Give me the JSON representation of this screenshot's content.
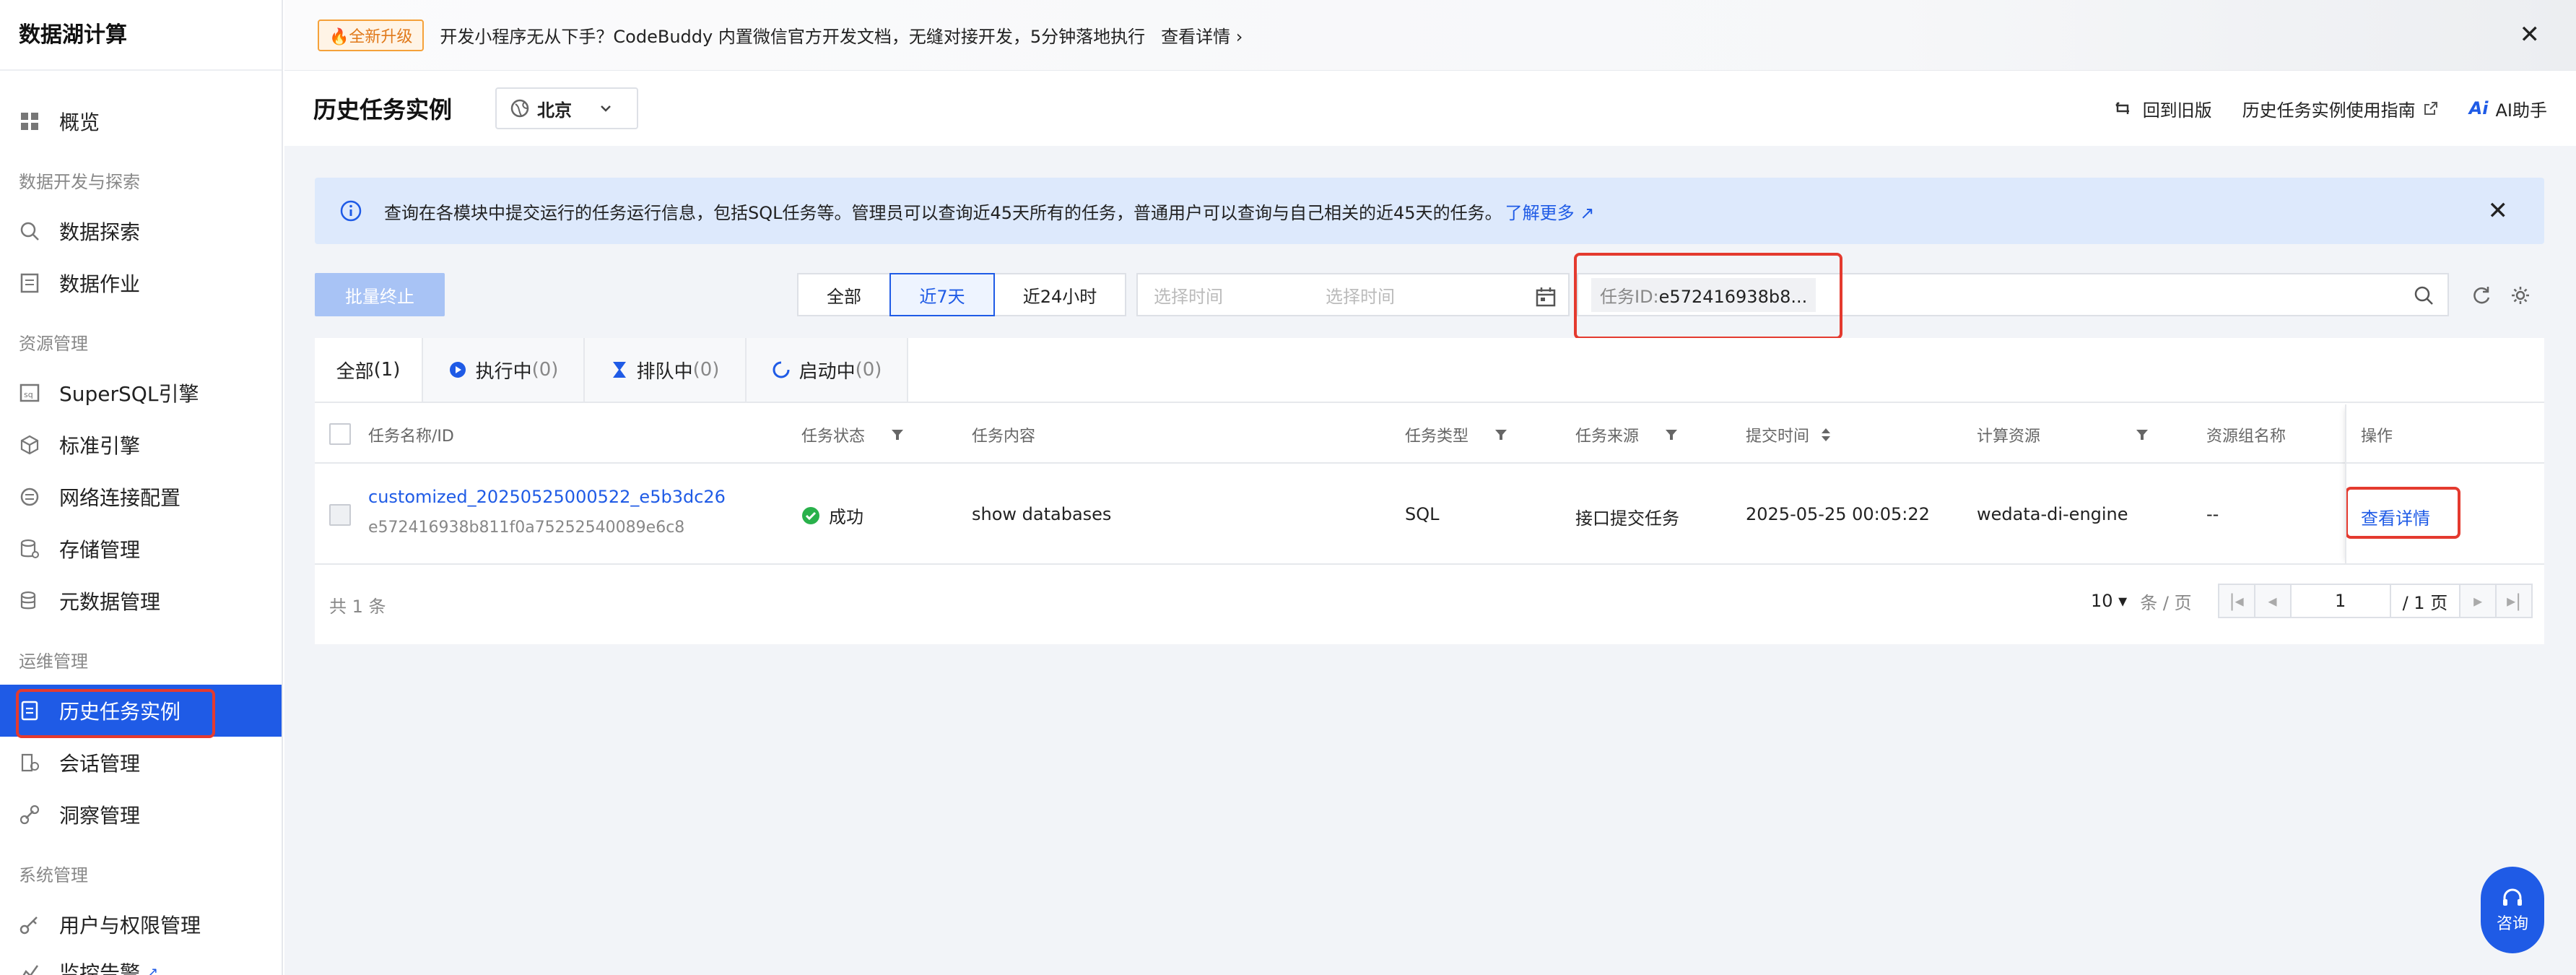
{
  "app": {
    "title": "数据湖计算"
  },
  "sidebar": {
    "items": [
      {
        "label": "概览",
        "icon": "dashboard-icon"
      },
      {
        "group": "数据开发与探索"
      },
      {
        "label": "数据探索",
        "icon": "explore-icon"
      },
      {
        "label": "数据作业",
        "icon": "job-icon"
      },
      {
        "group": "资源管理"
      },
      {
        "label": "SuperSQL引擎",
        "icon": "sql-engine-icon"
      },
      {
        "label": "标准引擎",
        "icon": "cube-icon"
      },
      {
        "label": "网络连接配置",
        "icon": "network-icon"
      },
      {
        "label": "存储管理",
        "icon": "storage-icon"
      },
      {
        "label": "元数据管理",
        "icon": "metadata-icon"
      },
      {
        "group": "运维管理"
      },
      {
        "label": "历史任务实例",
        "icon": "history-icon",
        "active": true
      },
      {
        "label": "会话管理",
        "icon": "session-icon"
      },
      {
        "label": "洞察管理",
        "icon": "insight-icon"
      },
      {
        "group": "系统管理"
      },
      {
        "label": "用户与权限管理",
        "icon": "key-icon"
      },
      {
        "label": "监控告警",
        "icon": "monitor-icon"
      }
    ]
  },
  "banner": {
    "badge": "全新升级",
    "text": "开发小程序无从下手？CodeBuddy 内置微信官方开发文档，无缝对接开发，5分钟落地执行",
    "link": "查看详情"
  },
  "header": {
    "title": "历史任务实例",
    "region": "北京",
    "actions": {
      "old_version": "回到旧版",
      "guide": "历史任务实例使用指南",
      "ai": "AI助手"
    }
  },
  "notice": {
    "text": "查询在各模块中提交运行的任务运行信息，包括SQL任务等。管理员可以查询近45天所有的任务，普通用户可以查询与自己相关的近45天的任务。",
    "link": "了解更多"
  },
  "toolbar": {
    "batch_stop": "批量终止",
    "ranges": [
      "全部",
      "近7天",
      "近24小时"
    ],
    "active_range": "近7天",
    "start_placeholder": "选择时间",
    "end_placeholder": "选择时间",
    "filter_key": "任务ID:",
    "filter_value": "e572416938b8..."
  },
  "tabs": [
    {
      "label": "全部",
      "count": "(1)"
    },
    {
      "label": "执行中",
      "count": "(0)"
    },
    {
      "label": "排队中",
      "count": "(0)"
    },
    {
      "label": "启动中",
      "count": "(0)"
    }
  ],
  "table": {
    "columns": [
      "任务名称/ID",
      "任务状态",
      "任务内容",
      "任务类型",
      "任务来源",
      "提交时间",
      "计算资源",
      "资源组名称",
      "操作"
    ],
    "rows": [
      {
        "name": "customized_20250525000522_e5b3dc26",
        "id": "e572416938b811f0a75252540089e6c8",
        "status": "成功",
        "content": "show databases",
        "type": "SQL",
        "source": "接口提交任务",
        "submit_time": "2025-05-25 00:05:22",
        "resource": "wedata-di-engine",
        "group": "--",
        "action": "查看详情"
      }
    ]
  },
  "footer": {
    "total": "共 1 条",
    "page_size": "10",
    "unit": "条 / 页",
    "page": "1",
    "pages": "/ 1 页"
  },
  "float": {
    "consult": "咨询"
  },
  "colors": {
    "accent": "#1f5be6",
    "highlight": "#e43a2f",
    "success": "#29b14b"
  }
}
